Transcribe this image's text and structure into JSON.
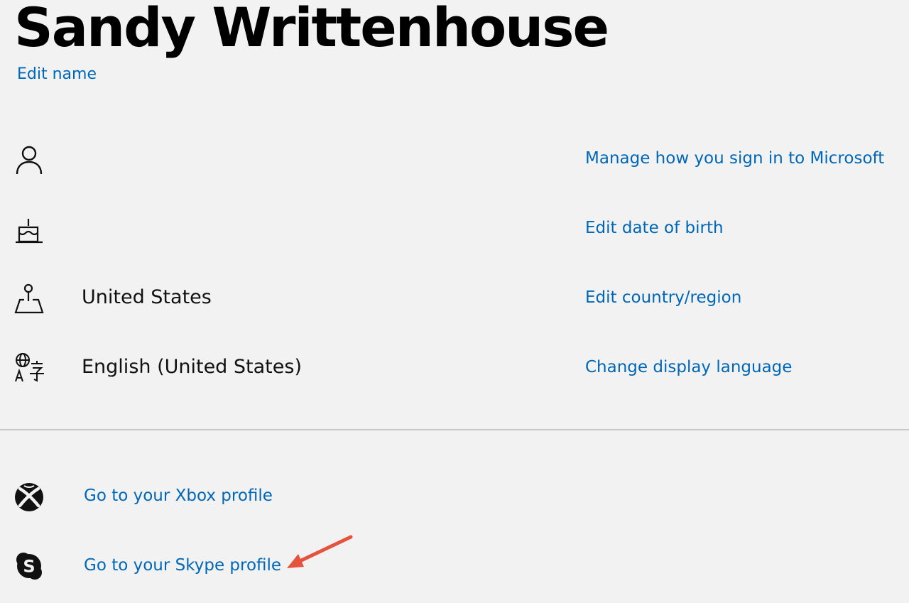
{
  "profile": {
    "name": "Sandy Writtenhouse",
    "edit_name_label": "Edit name"
  },
  "rows": [
    {
      "icon": "person-icon",
      "value": "",
      "action": "Manage how you sign in to Microsoft"
    },
    {
      "icon": "birthday-cake-icon",
      "value": "",
      "action": "Edit date of birth"
    },
    {
      "icon": "map-pin-icon",
      "value": "United States",
      "action": "Edit country/region"
    },
    {
      "icon": "language-icon",
      "value": "English (United States)",
      "action": "Change display language"
    }
  ],
  "profiles": [
    {
      "icon": "xbox-icon",
      "label": "Go to your Xbox profile"
    },
    {
      "icon": "skype-icon",
      "label": "Go to your Skype profile"
    }
  ],
  "colors": {
    "link": "#0067b8",
    "background": "#f2f2f2",
    "annotation_arrow": "#e5533d"
  }
}
